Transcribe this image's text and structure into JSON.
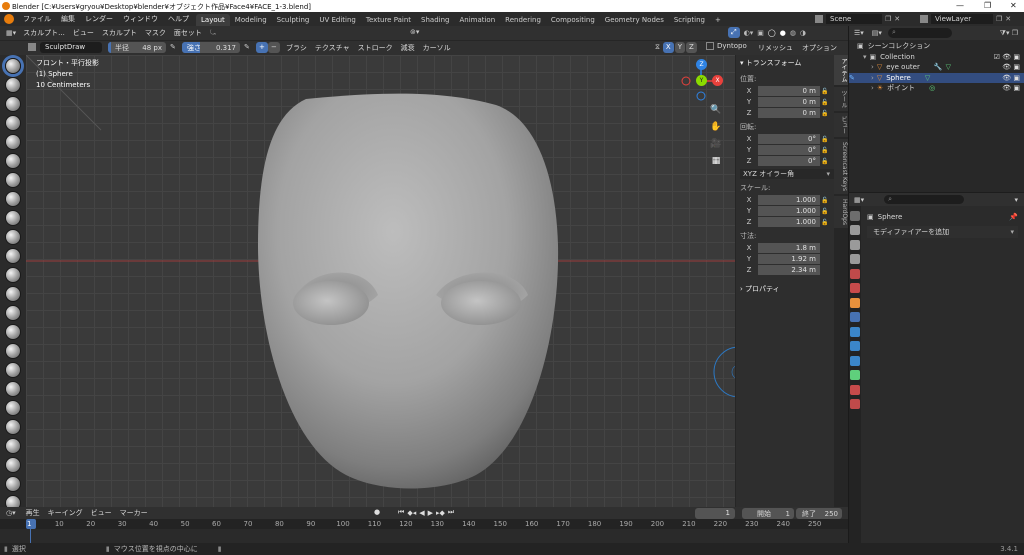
{
  "window": {
    "title": "Blender [C:¥Users¥gryou¥Desktop¥blender¥オブジェクト作品¥Face4¥FACE_1-3.blend]",
    "controls": [
      "—",
      "❐",
      "✕"
    ]
  },
  "menu": {
    "items": [
      "ファイル",
      "編集",
      "レンダー",
      "ウィンドウ",
      "ヘルプ"
    ],
    "workspaces": [
      "Layout",
      "Modeling",
      "Sculpting",
      "UV Editing",
      "Texture Paint",
      "Shading",
      "Animation",
      "Rendering",
      "Compositing",
      "Geometry Nodes",
      "Scripting"
    ],
    "active_workspace": "Layout",
    "add_tab": "+",
    "scene_label": "Scene",
    "viewlayer_label": "ViewLayer"
  },
  "header": {
    "mode": "スカルプト...",
    "menus": [
      "ビュー",
      "スカルプト",
      "マスク",
      "面セット"
    ],
    "brush_name": "SculptDraw",
    "radius_label": "半径",
    "radius_value": "48 px",
    "strength_label": "強さ",
    "strength_value": "0.317",
    "plus": "+",
    "minus": "−",
    "dropdowns": [
      "ブラシ",
      "テクスチャ",
      "ストローク",
      "減衰",
      "カーソル"
    ],
    "axes": [
      "X",
      "Y",
      "Z"
    ],
    "dyntopo": "Dyntopo",
    "remesh": "リメッシュ",
    "options": "オプション"
  },
  "viewport": {
    "view_name": "フロント・平行投影",
    "object_name": "(1) Sphere",
    "scale": "10 Centimeters",
    "gizmo": {
      "x": "X",
      "y": "Y",
      "z": "Z"
    }
  },
  "npanel": {
    "transform_title": "トランスフォーム",
    "location_label": "位置:",
    "location": [
      {
        "axis": "X",
        "value": "0 m"
      },
      {
        "axis": "Y",
        "value": "0 m"
      },
      {
        "axis": "Z",
        "value": "0 m"
      }
    ],
    "rotation_label": "回転:",
    "rotation": [
      {
        "axis": "X",
        "value": "0°"
      },
      {
        "axis": "Y",
        "value": "0°"
      },
      {
        "axis": "Z",
        "value": "0°"
      }
    ],
    "rotation_mode": "XYZ オイラー角",
    "scale_label": "スケール:",
    "scale": [
      {
        "axis": "X",
        "value": "1.000"
      },
      {
        "axis": "Y",
        "value": "1.000"
      },
      {
        "axis": "Z",
        "value": "1.000"
      }
    ],
    "dimensions_label": "寸法:",
    "dimensions": [
      {
        "axis": "X",
        "value": "1.8 m"
      },
      {
        "axis": "Y",
        "value": "1.92 m"
      },
      {
        "axis": "Z",
        "value": "2.34 m"
      }
    ],
    "properties_label": "プロパティ",
    "tabs": [
      "アイテム",
      "ツール",
      "ビュー",
      "Screencast Keys",
      "HardOps"
    ]
  },
  "outliner": {
    "scene_collection": "シーンコレクション",
    "collection": "Collection",
    "items": [
      "eye outer",
      "Sphere",
      "ポイント"
    ]
  },
  "properties": {
    "object_name": "Sphere",
    "add_modifier": "モディファイアーを追加"
  },
  "timeline": {
    "menus": [
      "再生",
      "キーイング",
      "ビュー",
      "マーカー"
    ],
    "current_frame": "1",
    "start_label": "開始",
    "start_value": "1",
    "end_label": "終了",
    "end_value": "250",
    "ticks": [
      "1",
      "10",
      "20",
      "30",
      "40",
      "50",
      "60",
      "70",
      "80",
      "90",
      "100",
      "110",
      "120",
      "130",
      "140",
      "150",
      "160",
      "170",
      "180",
      "190",
      "200",
      "210",
      "220",
      "230",
      "240",
      "250"
    ]
  },
  "status": {
    "select": "選択",
    "hint": "マウス位置を視点の中心に",
    "version": "3.4.1"
  },
  "colors": {
    "accent_blue": "#4772b3",
    "axis_red": "#e8413c",
    "axis_green": "#8bdc00",
    "axis_blue": "#2f83e3",
    "bg_viewport": "#3a3a3a"
  }
}
